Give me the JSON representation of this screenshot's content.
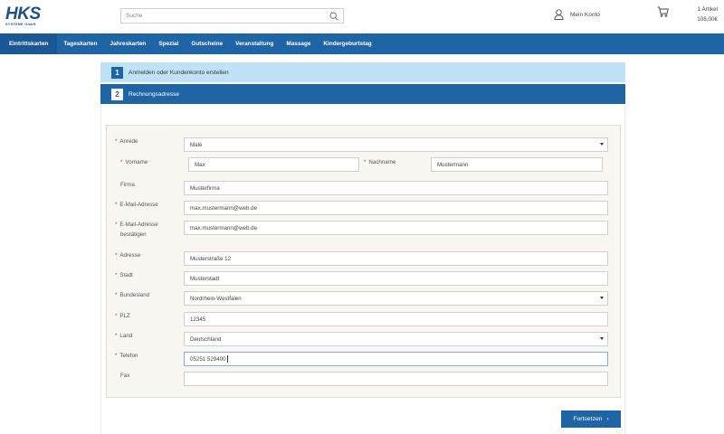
{
  "header": {
    "logo_main": "HKS",
    "logo_sub": "SYSTEME GmbH",
    "search_placeholder": "Suche",
    "account_label": "Mein Konto",
    "cart_count": "1 Artikel",
    "cart_total": "108,00€"
  },
  "nav": {
    "items": [
      {
        "label": "Eintrittskarten"
      },
      {
        "label": "Tageskarten"
      },
      {
        "label": "Jahreskarten"
      },
      {
        "label": "Spezial"
      },
      {
        "label": "Gutscheine"
      },
      {
        "label": "Veranstaltung"
      },
      {
        "label": "Massage"
      },
      {
        "label": "Kindergeburtstag"
      }
    ]
  },
  "steps": [
    {
      "number": "1",
      "label": "Anmelden oder Kundenkonto erstellen"
    },
    {
      "number": "2",
      "label": "Rechnungsadresse"
    }
  ],
  "form": {
    "required_mark": "*",
    "anrede": {
      "label": "Anrede",
      "value": "Male"
    },
    "vorname": {
      "label": "Vorname",
      "value": "Max"
    },
    "nachname": {
      "label": "Nachname",
      "value": "Mustermann"
    },
    "firma": {
      "label": "Firma",
      "value": "Musterfirma"
    },
    "email": {
      "label": "E-Mail-Adresse",
      "value": "max.mustermann@web.de"
    },
    "email_confirm": {
      "label_line1": "E-Mail-Adresse",
      "label_line2": "bestätigen",
      "value": "max.mustermann@web.de"
    },
    "adresse": {
      "label": "Adresse",
      "value": "Musterstraße 12"
    },
    "stadt": {
      "label": "Stadt",
      "value": "Musterstadt"
    },
    "bundesland": {
      "label": "Bundesland",
      "value": "Nordrhein-Westfalen"
    },
    "plz": {
      "label": "PLZ",
      "value": "12345"
    },
    "land": {
      "label": "Land",
      "value": "Deutschland"
    },
    "telefon": {
      "label": "Telefon",
      "value": "05251 529400"
    },
    "fax": {
      "label": "Fax",
      "value": ""
    }
  },
  "submit": {
    "label": "Fortsetzen",
    "arrow": "›"
  },
  "colors": {
    "primary": "#1f65a5",
    "step_light": "#bfe2f7",
    "form_bg": "#f9f7f2",
    "required": "#c0392b"
  }
}
